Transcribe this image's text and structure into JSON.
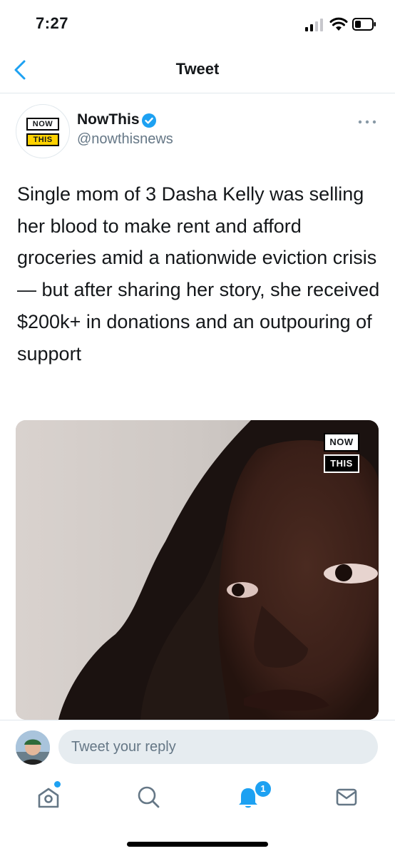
{
  "status_bar": {
    "time": "7:27"
  },
  "nav": {
    "title": "Tweet"
  },
  "tweet": {
    "display_name": "NowThis",
    "handle": "@nowthisnews",
    "logo_top": "NOW",
    "logo_bottom": "THIS",
    "text": "Single mom of 3 Dasha Kelly was selling her blood to make rent and afford groceries amid a nationwide eviction crisis — but after sharing her story, she received $200k+ in donations and an outpouring of support",
    "media_logo_top": "NOW",
    "media_logo_bottom": "THIS"
  },
  "reply": {
    "placeholder": "Tweet your reply"
  },
  "tabs": {
    "notifications_badge": "1",
    "icons": [
      "home-icon",
      "search-icon",
      "notifications-icon",
      "messages-icon"
    ]
  },
  "colors": {
    "accent": "#1da1f2",
    "text": "#14171a",
    "secondary_text": "#657786",
    "logo_yellow": "#ffd200"
  }
}
